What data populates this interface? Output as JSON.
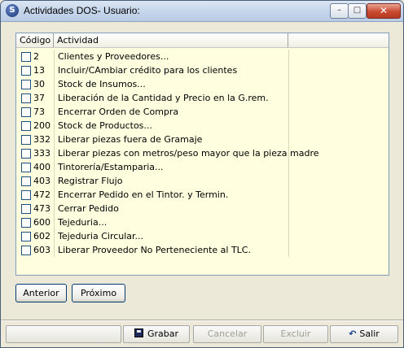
{
  "window": {
    "title": "Actividades DOS- Usuario:",
    "controls": [
      "minimize",
      "maximize",
      "close"
    ]
  },
  "grid": {
    "columns": [
      "Código",
      "Actividad",
      ""
    ],
    "rows": [
      {
        "code": "2",
        "activity": "Clientes y Proveedores...",
        "checked": false
      },
      {
        "code": "13",
        "activity": "Incluir/CAmbiar crédito para los clientes",
        "checked": false
      },
      {
        "code": "30",
        "activity": "Stock de Insumos...",
        "checked": false
      },
      {
        "code": "37",
        "activity": "Liberación de la Cantidad y Precio en la G.rem.",
        "checked": false
      },
      {
        "code": "73",
        "activity": "Encerrar Orden de Compra",
        "checked": false
      },
      {
        "code": "200",
        "activity": "Stock de Productos...",
        "checked": false
      },
      {
        "code": "332",
        "activity": "Liberar piezas fuera de Gramaje",
        "checked": false
      },
      {
        "code": "333",
        "activity": "Liberar piezas con metros/peso mayor que la pieza madre",
        "checked": false
      },
      {
        "code": "400",
        "activity": "Tintorería/Estamparia...",
        "checked": false
      },
      {
        "code": "403",
        "activity": "Registrar Flujo",
        "checked": false
      },
      {
        "code": "472",
        "activity": "Encerrar Pedido en el Tintor. y Termin.",
        "checked": false
      },
      {
        "code": "473",
        "activity": "Cerrar Pedido",
        "checked": false
      },
      {
        "code": "600",
        "activity": "Tejeduria...",
        "checked": false
      },
      {
        "code": "602",
        "activity": "Tejeduria Circular...",
        "checked": false
      },
      {
        "code": "603",
        "activity": "Liberar Proveedor No Perteneciente al TLC.",
        "checked": false
      }
    ]
  },
  "nav": {
    "prev_label": "Anterior",
    "next_label": "Próximo"
  },
  "toolbar": {
    "save_label": "Grabar",
    "cancel_label": "Cancelar",
    "delete_label": "Excluir",
    "exit_label": "Salir",
    "save_icon": "floppy-disk-icon",
    "exit_icon": "exit-arrow-icon"
  },
  "colors": {
    "grid_background": "#ffffe0",
    "disabled_text": "#a19f95"
  }
}
